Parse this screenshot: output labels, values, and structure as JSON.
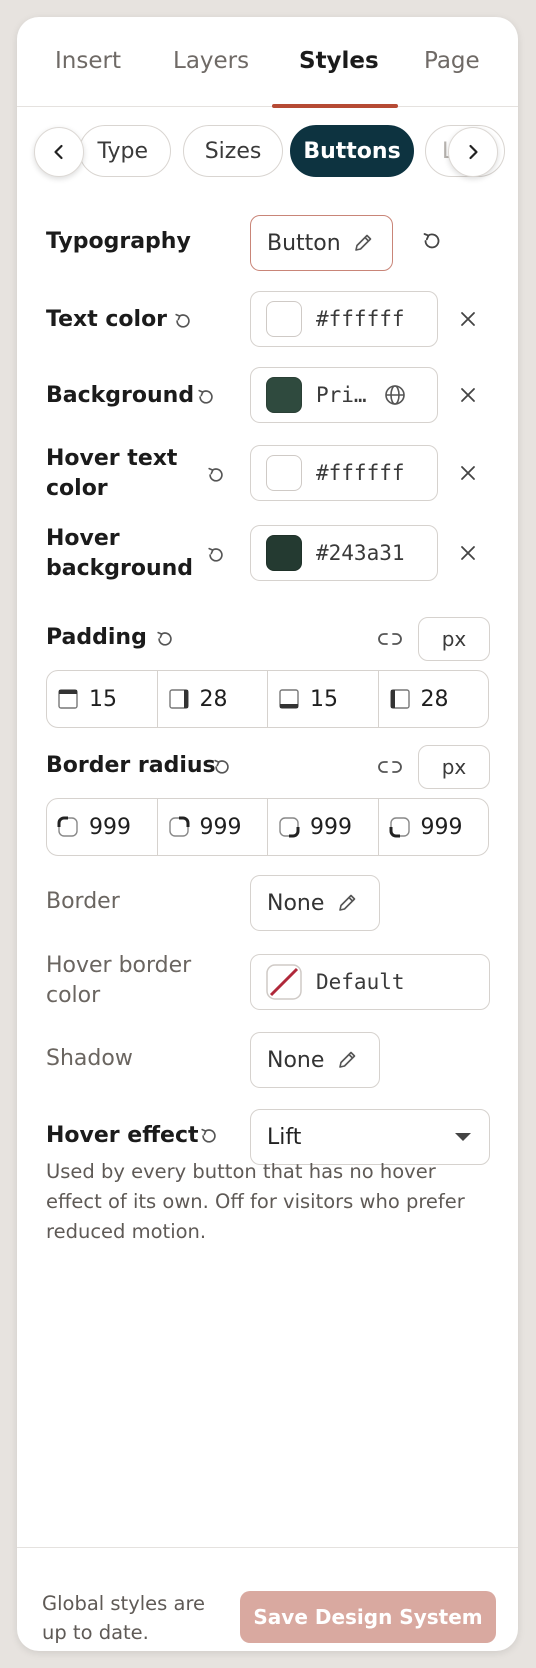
{
  "tabs": [
    {
      "label": "Insert"
    },
    {
      "label": "Layers"
    },
    {
      "label": "Styles"
    },
    {
      "label": "Page"
    }
  ],
  "active_tab": "Styles",
  "subnav": {
    "items": [
      {
        "label": "Type"
      },
      {
        "label": "Sizes"
      },
      {
        "label": "Buttons"
      },
      {
        "label": "L"
      }
    ],
    "active": "Buttons"
  },
  "rows": {
    "typography": {
      "label": "Typography",
      "value": "Button"
    },
    "text_color": {
      "label": "Text color",
      "value": "#ffffff",
      "swatch": "#ffffff"
    },
    "background": {
      "label": "Background",
      "value": "Pri…",
      "swatch": "#2f4a3e"
    },
    "hover_text_color": {
      "label_line1": "Hover text",
      "label_line2": "color",
      "value": "#ffffff",
      "swatch": "#ffffff"
    },
    "hover_background": {
      "label_line1": "Hover",
      "label_line2": "background",
      "value": "#243a31",
      "swatch": "#243a31"
    },
    "padding": {
      "label": "Padding",
      "unit": "px",
      "values": [
        "15",
        "28",
        "15",
        "28"
      ]
    },
    "border_radius": {
      "label": "Border radius",
      "unit": "px",
      "values": [
        "999",
        "999",
        "999",
        "999"
      ]
    },
    "border": {
      "label": "Border",
      "value": "None"
    },
    "hover_border_color": {
      "label_line1": "Hover border",
      "label_line2": "color",
      "value": "Default"
    },
    "shadow": {
      "label": "Shadow",
      "value": "None"
    },
    "hover_effect": {
      "label": "Hover effect",
      "value": "Lift"
    }
  },
  "description": "Used by every button that has no hover effect of its own. Off for visitors who prefer reduced motion.",
  "footer": {
    "status": "Global styles are up to date.",
    "save_label": "Save Design System"
  },
  "colors": {
    "accent": "#b64a34",
    "active_pill": "#0d3340",
    "save_button": "#d9a9a0"
  }
}
